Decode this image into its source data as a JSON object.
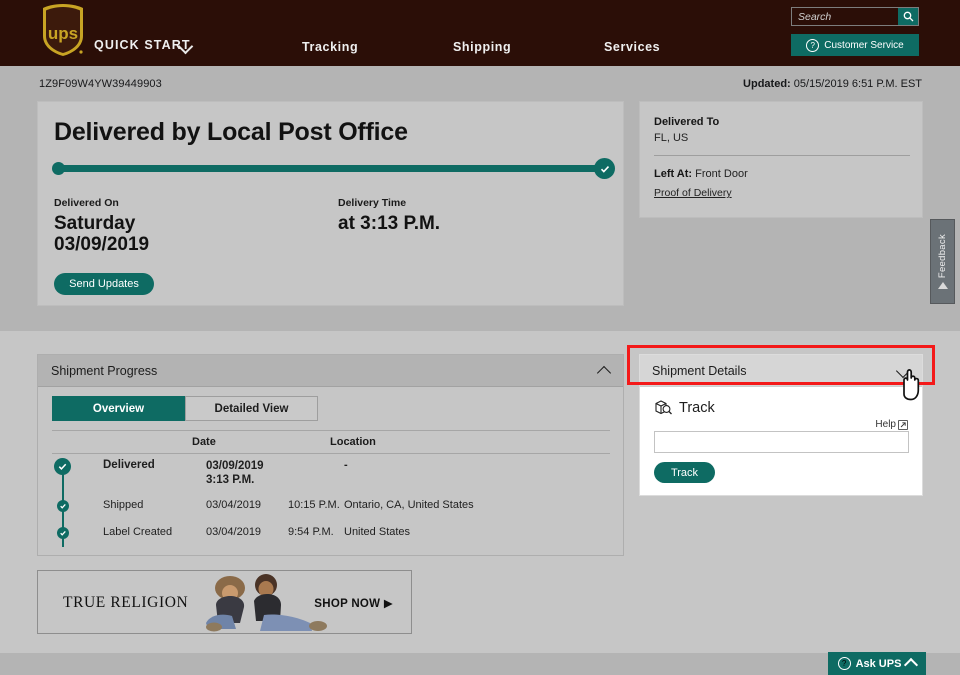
{
  "header": {
    "logo_alt": "UPS",
    "quick_start": "QUICK START",
    "nav": [
      {
        "label": "Tracking"
      },
      {
        "label": "Shipping"
      },
      {
        "label": "Services"
      }
    ],
    "search": {
      "placeholder": "Search",
      "value": ""
    },
    "customer_service": "Customer Service"
  },
  "tracking_bar": {
    "tracking_number": "1Z9F09W4YW39449903",
    "updated_label": "Updated:",
    "updated_value": "05/15/2019 6:51 P.M. EST"
  },
  "delivery": {
    "status_title": "Delivered by Local Post Office",
    "delivered_on_label": "Delivered On",
    "delivered_on_day": "Saturday",
    "delivered_on_date": "03/09/2019",
    "delivery_time_label": "Delivery Time",
    "delivery_time_value": "at 3:13 P.M.",
    "send_updates": "Send Updates",
    "progress_percent": 100
  },
  "delivered_to": {
    "title": "Delivered To",
    "address": "FL, US",
    "left_at_label": "Left At:",
    "left_at_value": "Front Door",
    "proof_of_delivery": "Proof of Delivery"
  },
  "feedback": {
    "label": "Feedback"
  },
  "shipment_progress": {
    "title": "Shipment Progress",
    "tabs": [
      {
        "label": "Overview",
        "active": true
      },
      {
        "label": "Detailed View",
        "active": false
      }
    ],
    "columns": {
      "status": "",
      "date": "Date",
      "location": "Location"
    },
    "rows": [
      {
        "status": "Delivered",
        "date": "03/09/2019",
        "time": "3:13 P.M.",
        "location": "-"
      },
      {
        "status": "Shipped",
        "date": "03/04/2019",
        "time": "10:15 P.M.",
        "location": "Ontario, CA, United States"
      },
      {
        "status": "Label Created",
        "date": "03/04/2019",
        "time": "9:54 P.M.",
        "location": "United States"
      }
    ]
  },
  "shipment_details": {
    "header": "Shipment Details",
    "track_heading": "Track",
    "help_label": "Help",
    "input_value": "",
    "input_placeholder": "",
    "track_button": "Track"
  },
  "ad": {
    "brand": "True Religion",
    "cta": "SHOP NOW"
  },
  "ask_ups": {
    "label": "Ask UPS"
  },
  "colors": {
    "brand_brown": "#2b0e07",
    "brand_gold": "#c8a424",
    "teal": "#0e6b63",
    "page_bg": "#b4b4b4",
    "card_bg": "#c6c6c6",
    "highlight_red": "#f41919"
  }
}
